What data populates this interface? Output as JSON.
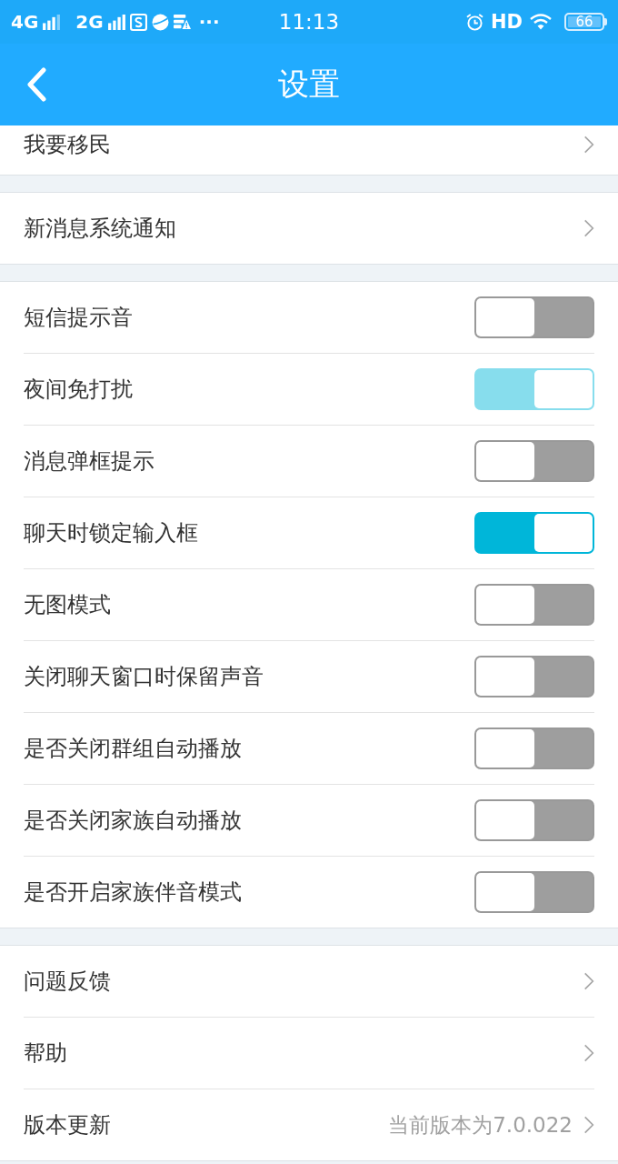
{
  "status_bar": {
    "network_1": "4G",
    "network_2": "2G",
    "overflow": "···",
    "time": "11:13",
    "hd": "HD",
    "battery": "66"
  },
  "nav_bar": {
    "title": "设置"
  },
  "sections": [
    {
      "items": [
        {
          "kind": "link",
          "label": "我要移民"
        }
      ]
    },
    {
      "items": [
        {
          "kind": "link",
          "label": "新消息系统通知"
        }
      ]
    },
    {
      "items": [
        {
          "kind": "toggle",
          "label": "短信提示音",
          "on": false,
          "disabled": false
        },
        {
          "kind": "toggle",
          "label": "夜间免打扰",
          "on": true,
          "disabled": true
        },
        {
          "kind": "toggle",
          "label": "消息弹框提示",
          "on": false,
          "disabled": false
        },
        {
          "kind": "toggle",
          "label": "聊天时锁定输入框",
          "on": true,
          "disabled": false
        },
        {
          "kind": "toggle",
          "label": "无图模式",
          "on": false,
          "disabled": false
        },
        {
          "kind": "toggle",
          "label": "关闭聊天窗口时保留声音",
          "on": false,
          "disabled": false
        },
        {
          "kind": "toggle",
          "label": "是否关闭群组自动播放",
          "on": false,
          "disabled": false
        },
        {
          "kind": "toggle",
          "label": "是否关闭家族自动播放",
          "on": false,
          "disabled": false
        },
        {
          "kind": "toggle",
          "label": "是否开启家族伴音模式",
          "on": false,
          "disabled": false
        }
      ]
    },
    {
      "items": [
        {
          "kind": "link",
          "label": "问题反馈"
        },
        {
          "kind": "link",
          "label": "帮助"
        },
        {
          "kind": "link",
          "label": "版本更新",
          "value": "当前版本为7.0.022"
        }
      ]
    }
  ]
}
